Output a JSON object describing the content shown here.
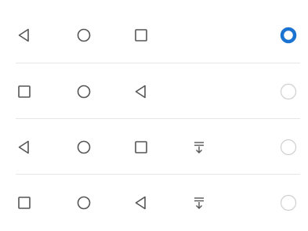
{
  "nav_bar_options": [
    {
      "buttons": [
        "back-icon",
        "home-icon",
        "recents-icon"
      ],
      "selected": true
    },
    {
      "buttons": [
        "recents-icon",
        "home-icon",
        "back-icon"
      ],
      "selected": false
    },
    {
      "buttons": [
        "back-icon",
        "home-icon",
        "recents-icon",
        "notification-pulldown-icon"
      ],
      "selected": false
    },
    {
      "buttons": [
        "recents-icon",
        "home-icon",
        "back-icon",
        "notification-pulldown-icon"
      ],
      "selected": false
    }
  ],
  "colors": {
    "icon_stroke": "#555555",
    "radio_selected": "#1a73d1",
    "radio_unselected": "#cfcfcf",
    "divider": "#e6e6e6"
  }
}
